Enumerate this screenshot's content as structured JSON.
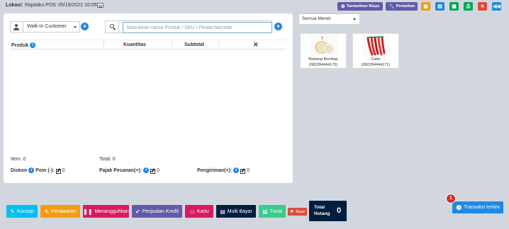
{
  "topbar": {
    "location_label": "Lokasi:",
    "location_value": "Rajolaku POS",
    "date": "05/19/2022 10:05",
    "add_expense_label": "Tambahkan Biaya",
    "repair_label": "Perbaikan"
  },
  "colors": {
    "primary": "#1e88e5",
    "purple": "#605ca8",
    "orange": "#f39c12",
    "green": "#00a65a",
    "red": "#dd4b39",
    "navy": "#001f3f",
    "teal": "#00c0ef",
    "pink": "#d81b60",
    "aqua": "#39cccc"
  },
  "customer": {
    "selected": "Walk-In Customer"
  },
  "search": {
    "placeholder": "Masukkan nama Produk / SKU / Pindai barcode"
  },
  "cart_table": {
    "headers": [
      "Produk",
      "Kuantitas",
      "Subtotal",
      "✕"
    ]
  },
  "summary": {
    "items_label": "Item:",
    "items_value": "0",
    "total_label": "Total:",
    "total_value": "0",
    "discount_label": "Diskon",
    "points_label": "Poin (-):",
    "discount_value": "0",
    "tax_label": "Pajak Pesanan(+):",
    "tax_value": "0",
    "shipping_label": "Pengiriman(+):",
    "shipping_value": "0"
  },
  "brand_filter": {
    "selected": "Semua Merek"
  },
  "products": [
    {
      "name": "Bawang Bombay",
      "sku": "(082284444170)",
      "image": "onion"
    },
    {
      "name": "Cabe",
      "sku": "(082284444171)",
      "image": "chili"
    }
  ],
  "bottom_bar": {
    "draft": "Konsep",
    "quotation": "Penawaran",
    "suspend": "Menangguhkan",
    "credit_sale": "Penjualan Kredit",
    "card": "Kartu",
    "multi_pay": "Multi Bayar",
    "cash": "Tunai",
    "cancel": "Batal",
    "total_due_label": "Total\nHutang",
    "total_due_value": "0"
  },
  "recent": {
    "label": "Transaksi terkini",
    "badge": "1"
  }
}
